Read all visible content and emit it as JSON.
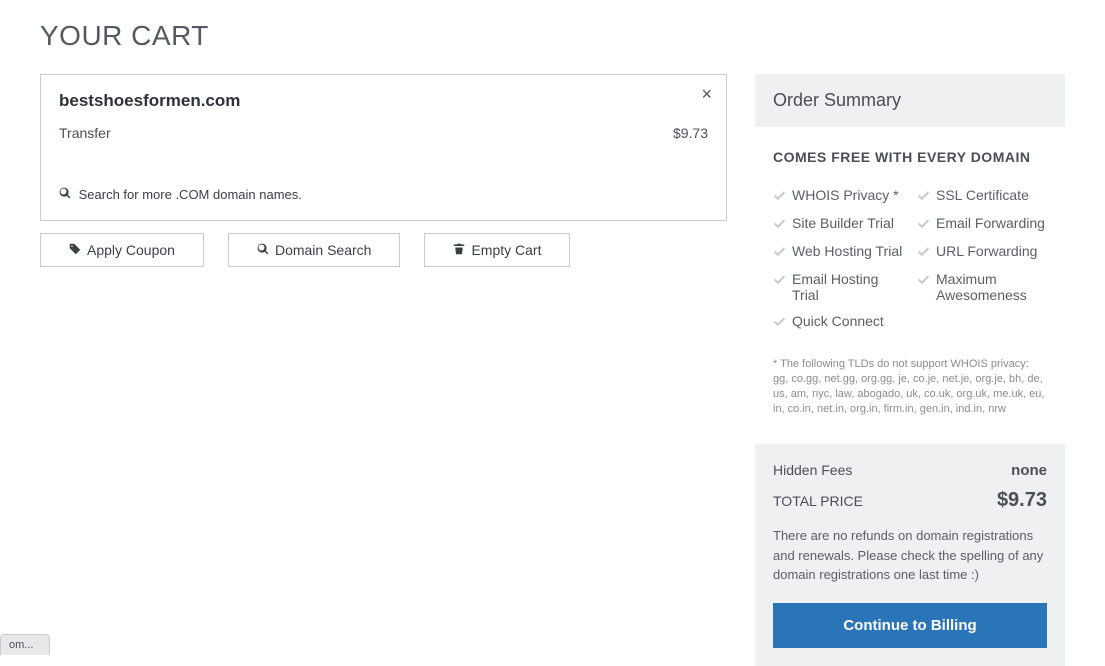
{
  "title": "YOUR CART",
  "cart_item": {
    "domain": "bestshoesformen.com",
    "line_label": "Transfer",
    "line_price": "$9.73",
    "search_more": "Search for more .COM domain names."
  },
  "buttons": {
    "apply_coupon": "Apply Coupon",
    "domain_search": "Domain Search",
    "empty_cart": "Empty Cart"
  },
  "summary": {
    "heading": "Order Summary",
    "free_title": "COMES FREE WITH EVERY DOMAIN",
    "features_left": [
      "WHOIS Privacy *",
      "Site Builder Trial",
      "Web Hosting Trial",
      "Email Hosting Trial",
      "Quick Connect"
    ],
    "features_right": [
      "SSL Certificate",
      "Email Forwarding",
      "URL Forwarding",
      "Maximum Awesomeness"
    ],
    "footnote": "* The following TLDs do not support WHOIS privacy: gg, co.gg, net.gg, org.gg, je, co.je, net.je, org.je, bh, de, us, am, nyc, law, abogado, uk, co.uk, org.uk, me.uk, eu, in, co.in, net.in, org.in, firm.in, gen.in, ind.in, nrw"
  },
  "totals": {
    "hidden_label": "Hidden Fees",
    "hidden_value": "none",
    "total_label": "TOTAL PRICE",
    "total_value": "$9.73",
    "refund_note": "There are no refunds on domain registrations and renewals. Please check the spelling of any domain registrations one last time :)",
    "cta": "Continue to Billing"
  },
  "tab_stub": "om..."
}
